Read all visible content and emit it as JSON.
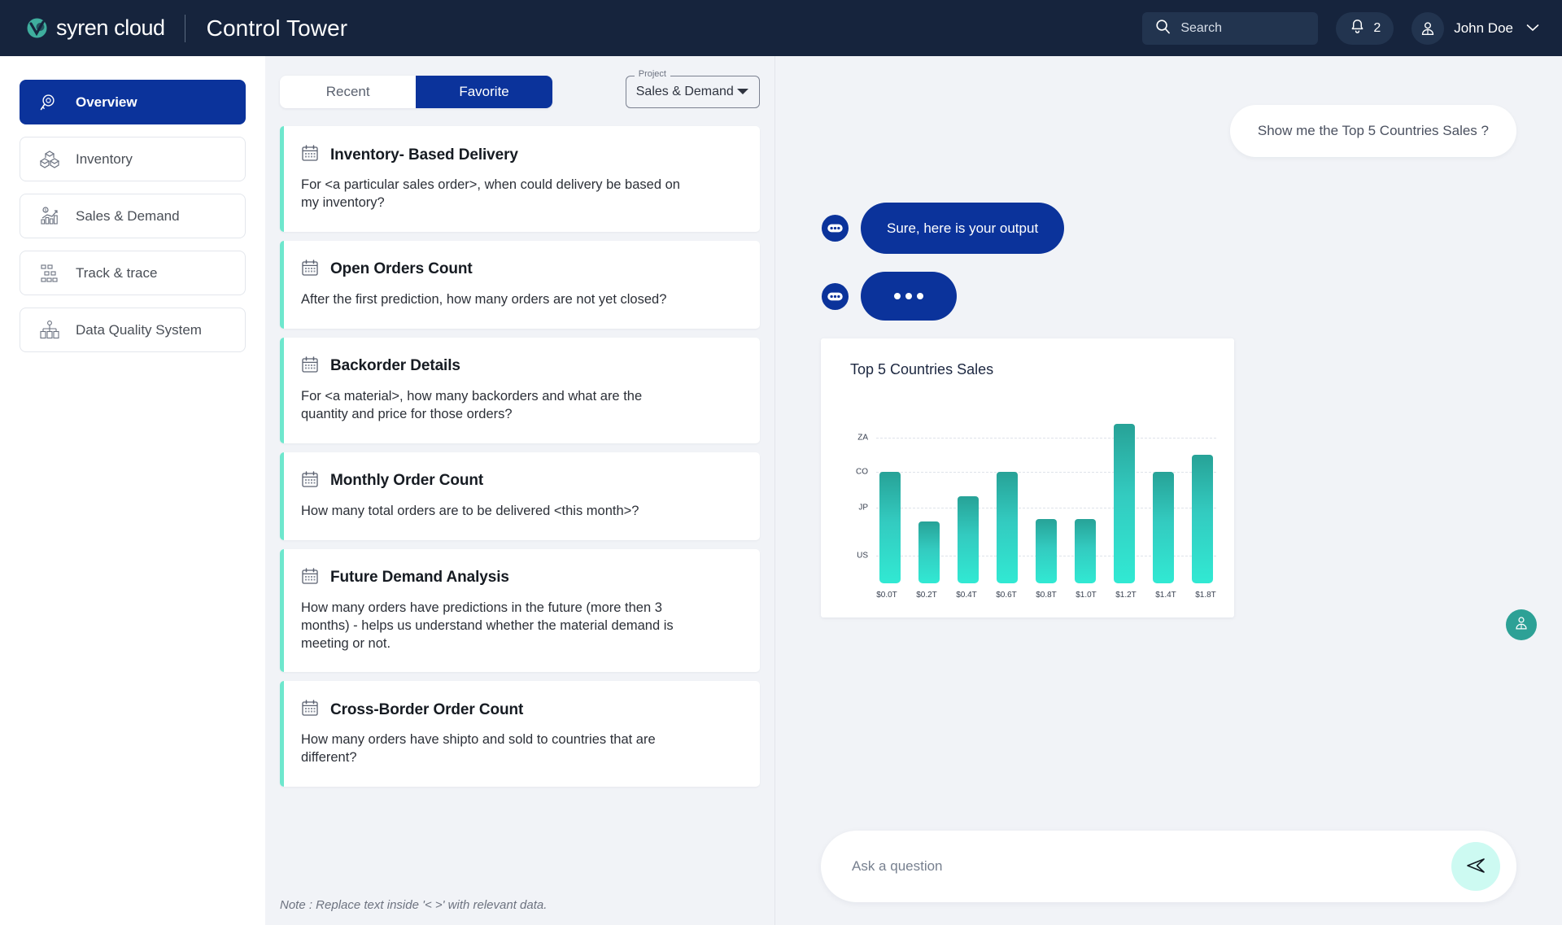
{
  "header": {
    "brand": "syren cloud",
    "brand_mark_icon": "syren-logo-icon",
    "app_title": "Control Tower",
    "search_placeholder": "Search",
    "search_icon": "search-icon",
    "bell_icon": "bell-icon",
    "notification_count": "2",
    "user_icon": "user-avatar-icon",
    "user_name": "John Doe",
    "caret_icon": "chevron-down-icon",
    "bg_color": "#16243d"
  },
  "sidebar": {
    "items": [
      {
        "label": "Overview",
        "icon": "magnifier-overview-icon",
        "active": true
      },
      {
        "label": "Inventory",
        "icon": "boxes-icon",
        "active": false
      },
      {
        "label": "Sales & Demand",
        "icon": "bar-chart-dollar-icon",
        "active": false
      },
      {
        "label": "Track & trace",
        "icon": "network-nodes-icon",
        "active": false
      },
      {
        "label": "Data Quality System",
        "icon": "hierarchy-icon",
        "active": false
      }
    ],
    "active_color": "#0b339b"
  },
  "middle": {
    "tabs": [
      {
        "label": "Recent",
        "active": false
      },
      {
        "label": "Favorite",
        "active": true
      }
    ],
    "project_select": {
      "legend": "Project",
      "value": "Sales & Demand",
      "caret_icon": "chevron-down-icon"
    },
    "card_icon": "calendar-icon",
    "accent_color": "#6ee7cd",
    "cards": [
      {
        "title": "Inventory- Based Delivery",
        "desc": "For <a particular sales order>, when could delivery be based on my inventory?"
      },
      {
        "title": "Open Orders Count",
        "desc": "After the first prediction, how many orders are not yet closed?"
      },
      {
        "title": "Backorder Details",
        "desc": "For <a material>, how many backorders and what are the quantity and price for those orders?"
      },
      {
        "title": "Monthly Order Count",
        "desc": "How many total orders are to be delivered <this month>?"
      },
      {
        "title": "Future Demand Analysis",
        "desc": "How many orders have predictions in the future (more then 3 months) - helps us understand whether the material demand is meeting or not."
      },
      {
        "title": "Cross-Border Order Count",
        "desc": "How many orders have shipto and sold to countries that are different?"
      }
    ],
    "note": "Note : Replace text inside '< >' with relevant data."
  },
  "chat": {
    "user_message": "Show me the Top 5 Countries Sales ?",
    "bot_message": "Sure, here is your output",
    "bot_typing": "•••",
    "bot_avatar_icon": "chat-bubble-dots-icon",
    "bubble_color": "#0b339b",
    "composer_placeholder": "Ask a question",
    "composer_value": "",
    "send_icon": "send-paper-plane-icon",
    "fab_icon": "support-agent-icon",
    "fab_color": "#2da196"
  },
  "chart_data": {
    "type": "bar",
    "title": "Top 5 Countries Sales",
    "xlabel": "",
    "ylabel": "",
    "grid": true,
    "legend": "none",
    "categories": [
      "$0.0T",
      "$0.2T",
      "$0.4T",
      "$0.6T",
      "$0.8T",
      "$1.0T",
      "$1.2T",
      "$1.4T",
      "$1.8T"
    ],
    "values": [
      2.0,
      1.1,
      1.55,
      2.0,
      1.15,
      1.15,
      2.85,
      2.0,
      2.3
    ],
    "ytick_labels": [
      "US",
      "JP",
      "CO",
      "ZA"
    ],
    "ytick_values": [
      0.5,
      1.35,
      2.0,
      2.6
    ],
    "ylim": [
      0,
      3.2
    ],
    "bar_gradient_top": "#27a297",
    "bar_gradient_bottom": "#31e9d3"
  }
}
